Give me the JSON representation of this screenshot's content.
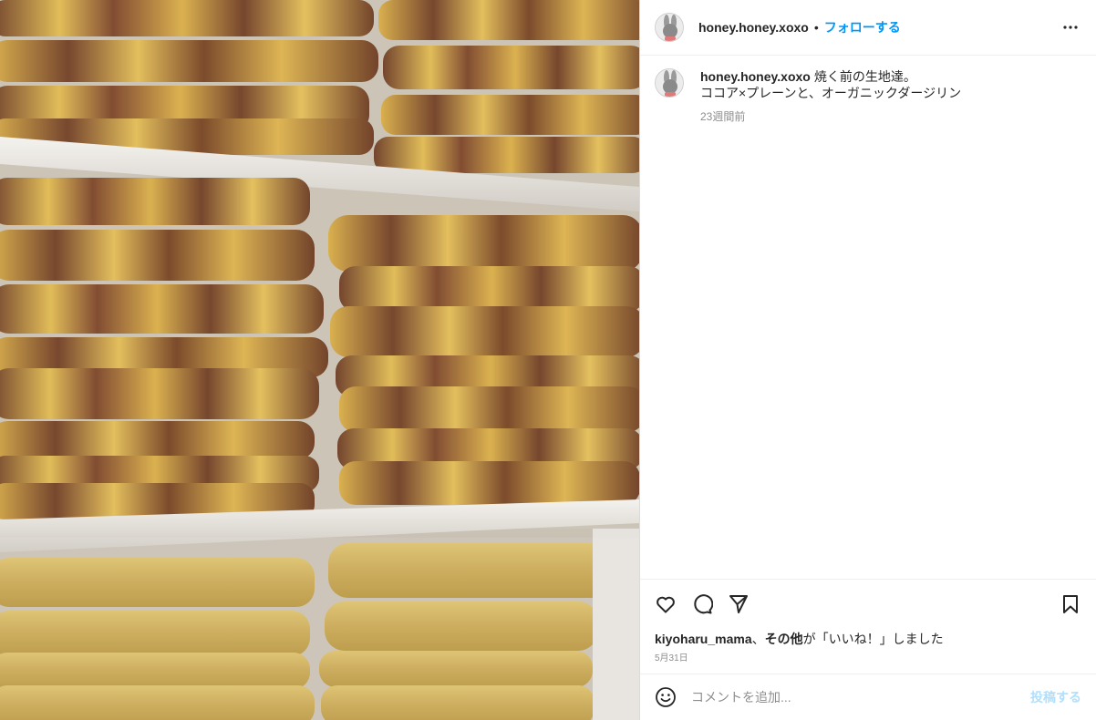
{
  "post": {
    "username": "honey.honey.xoxo",
    "separator": "•",
    "follow_label": "フォローする",
    "more_icon": "more-horizontal-icon",
    "caption": {
      "username": "honey.honey.xoxo",
      "text": "焼く前の生地達。\nココア×プレーンと、オーガニックダージリン",
      "time": "23週間前"
    },
    "actions": {
      "like_icon": "heart-icon",
      "comment_icon": "comment-icon",
      "share_icon": "share-icon",
      "save_icon": "bookmark-icon"
    },
    "likes": {
      "liker": "kiyoharu_mama",
      "separator": "、",
      "others": "その他",
      "suffix": "が「いいね！」しました"
    },
    "date": "5月31日",
    "comment_input": {
      "placeholder": "コメントを追加...",
      "post_label": "投稿する",
      "emoji_icon": "smiley-icon"
    }
  },
  "colors": {
    "accent": "#0095f6",
    "accent_disabled": "#b2dffc",
    "muted_text": "#8e8e8e"
  }
}
